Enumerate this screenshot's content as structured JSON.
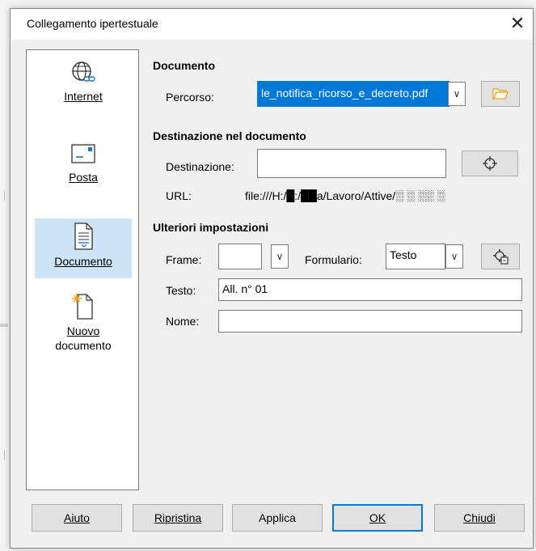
{
  "dialog": {
    "title": "Collegamento ipertestuale",
    "close_glyph": "✕"
  },
  "sidebar": {
    "items": [
      {
        "label": "Internet",
        "icon": "globe-link-icon",
        "selected": false
      },
      {
        "label": "Posta",
        "icon": "mail-icon",
        "selected": false
      },
      {
        "label": "Documento",
        "icon": "document-icon",
        "selected": true
      },
      {
        "label_line1": "Nuovo",
        "label_line2": "documento",
        "icon": "new-document-icon",
        "selected": false
      }
    ]
  },
  "document_section": {
    "title": "Documento",
    "path_label": "Percorso:",
    "path_value": "le_notifica_ricorso_e_decreto.pdf"
  },
  "target_section": {
    "title": "Destinazione nel documento",
    "target_label": "Destinazione:",
    "target_value": "",
    "url_label": "URL:",
    "url_value": "file:///H:/█:/██a/Lavoro/Attive/░ ░ ░░ ░"
  },
  "more_settings": {
    "title": "Ulteriori impostazioni",
    "frame_label": "Frame:",
    "frame_value": "",
    "form_label": "Formulario:",
    "form_value": "Testo",
    "text_label": "Testo:",
    "text_value": "All. n° 01",
    "name_label": "Nome:",
    "name_value": ""
  },
  "buttons": {
    "help": "Aiuto",
    "reset": "Ripristina",
    "apply": "Applica",
    "ok": "OK",
    "close": "Chiudi"
  },
  "colors": {
    "selection": "#0078d7",
    "selected_item_bg": "#cce4f7",
    "folder_icon": "#e8a317"
  }
}
